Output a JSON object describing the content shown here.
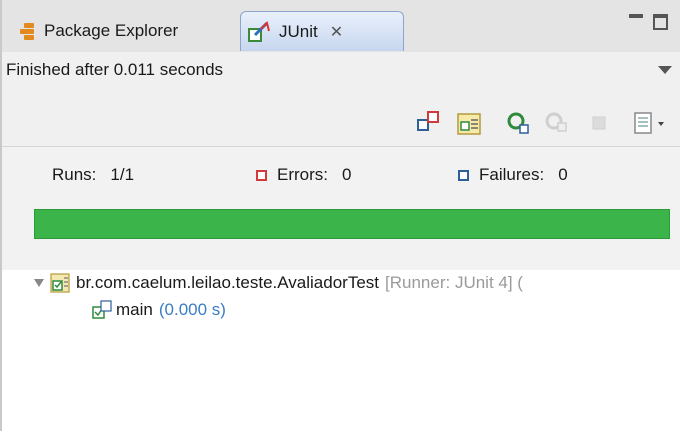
{
  "tabs": [
    {
      "label": "Package Explorer",
      "icon": "package-explorer-icon"
    },
    {
      "label": "JUnit",
      "icon": "junit-icon",
      "active": true
    }
  ],
  "close_glyph": "✕",
  "status": {
    "text": "Finished after 0.011 seconds"
  },
  "toolbar": {
    "buttons": [
      "next-failure-icon",
      "previous-failure-icon",
      "rerun-test-icon",
      "rerun-failed-first-icon",
      "stop-icon",
      "history-icon"
    ]
  },
  "counters": {
    "runs_label": "Runs:",
    "runs_value": "1/1",
    "errors_label": "Errors:",
    "errors_value": "0",
    "failures_label": "Failures:",
    "failures_value": "0"
  },
  "progress": {
    "fraction": 1.0,
    "color": "#3bb54a"
  },
  "tree": {
    "suite": {
      "name": "br.com.caelum.leilao.teste.AvaliadorTest",
      "runner": "[Runner: JUnit 4] ("
    },
    "case": {
      "name": "main",
      "time": "(0.000 s)"
    }
  },
  "colors": {
    "success": "#3bb54a",
    "error": "#d23b3b",
    "failure": "#2f5f99",
    "time_text": "#3c7cc4"
  }
}
